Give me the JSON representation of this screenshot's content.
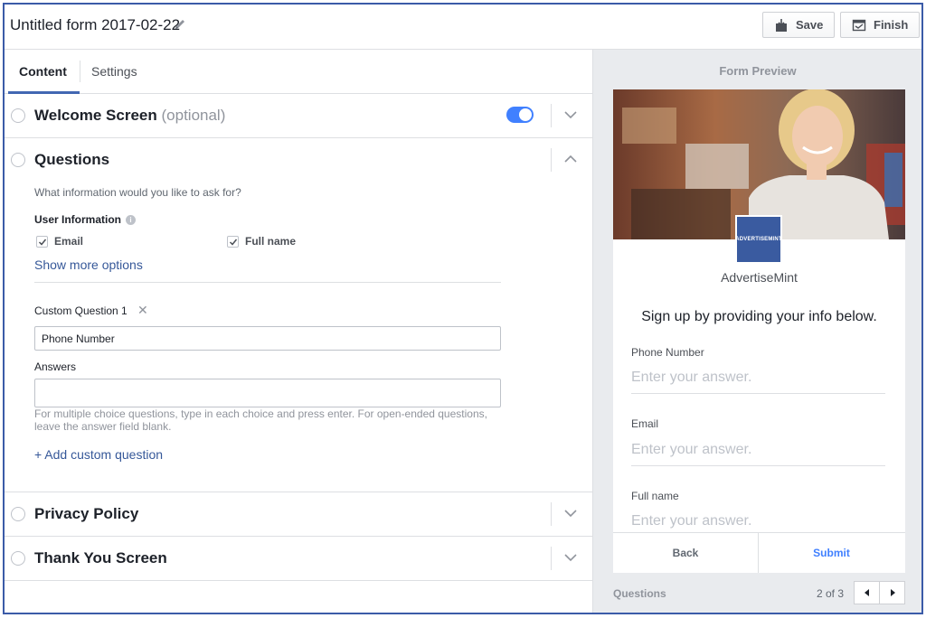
{
  "header": {
    "title": "Untitled form 2017-02-22",
    "save_label": "Save",
    "finish_label": "Finish"
  },
  "tabs": [
    {
      "label": "Content",
      "active": true
    },
    {
      "label": "Settings",
      "active": false
    }
  ],
  "welcome": {
    "title": "Welcome Screen",
    "optional": "(optional)",
    "toggle_on": true
  },
  "questions": {
    "title": "Questions",
    "prompt": "What information would you like to ask for?",
    "user_info_label": "User Information",
    "fields": [
      {
        "label": "Email",
        "checked": true
      },
      {
        "label": "Full name",
        "checked": true
      }
    ],
    "show_more": "Show more options",
    "custom_label": "Custom Question 1",
    "custom_value": "Phone Number",
    "answers_label": "Answers",
    "answers_value": "",
    "answers_note": "For multiple choice questions, type in each choice and press enter. For open-ended questions, leave the answer field blank.",
    "add_custom": "+ Add custom question"
  },
  "privacy": {
    "title": "Privacy Policy"
  },
  "thankyou": {
    "title": "Thank You Screen"
  },
  "preview": {
    "title": "Form Preview",
    "logo_text": "ADVERTISEMINT",
    "brand": "AdvertiseMint",
    "headline": "Sign up by providing your info below.",
    "fields": [
      {
        "label": "Phone Number",
        "placeholder": "Enter your answer."
      },
      {
        "label": "Email",
        "placeholder": "Enter your answer."
      },
      {
        "label": "Full name",
        "placeholder": "Enter your answer."
      }
    ],
    "back_label": "Back",
    "submit_label": "Submit",
    "footer_label": "Questions",
    "page_indicator": "2 of 3"
  },
  "colors": {
    "accent": "#4267b2",
    "link": "#365899",
    "toggle": "#4080ff",
    "submit": "#4080ff",
    "frame_border": "#3b5ba8"
  },
  "icons": [
    "pencil-icon",
    "save-icon",
    "finish-icon",
    "chevron-down-icon",
    "chevron-up-icon",
    "info-icon",
    "check-icon",
    "close-icon",
    "arrow-left-icon",
    "arrow-right-icon"
  ]
}
